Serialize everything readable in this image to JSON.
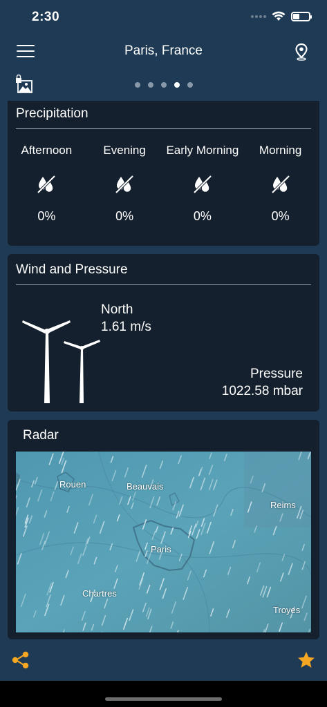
{
  "status_bar": {
    "time": "2:30"
  },
  "header": {
    "title": "Paris, France"
  },
  "pager": {
    "count": 5,
    "active_index": 3
  },
  "precipitation": {
    "title": "Precipitation",
    "periods": [
      {
        "label": "Afternoon",
        "value": "0%"
      },
      {
        "label": "Evening",
        "value": "0%"
      },
      {
        "label": "Early Morning",
        "value": "0%"
      },
      {
        "label": "Morning",
        "value": "0%"
      }
    ]
  },
  "wind": {
    "title": "Wind and Pressure",
    "direction": "North",
    "speed": "1.61 m/s",
    "pressure_label": "Pressure",
    "pressure_value": "1022.58 mbar"
  },
  "radar": {
    "title": "Radar",
    "places": [
      "Rouen",
      "Beauvais",
      "Reims",
      "Paris",
      "Chartres",
      "Troyes"
    ]
  },
  "colors": {
    "accent": "#f5a623",
    "background": "#1e3a54",
    "card": "#14202d"
  }
}
